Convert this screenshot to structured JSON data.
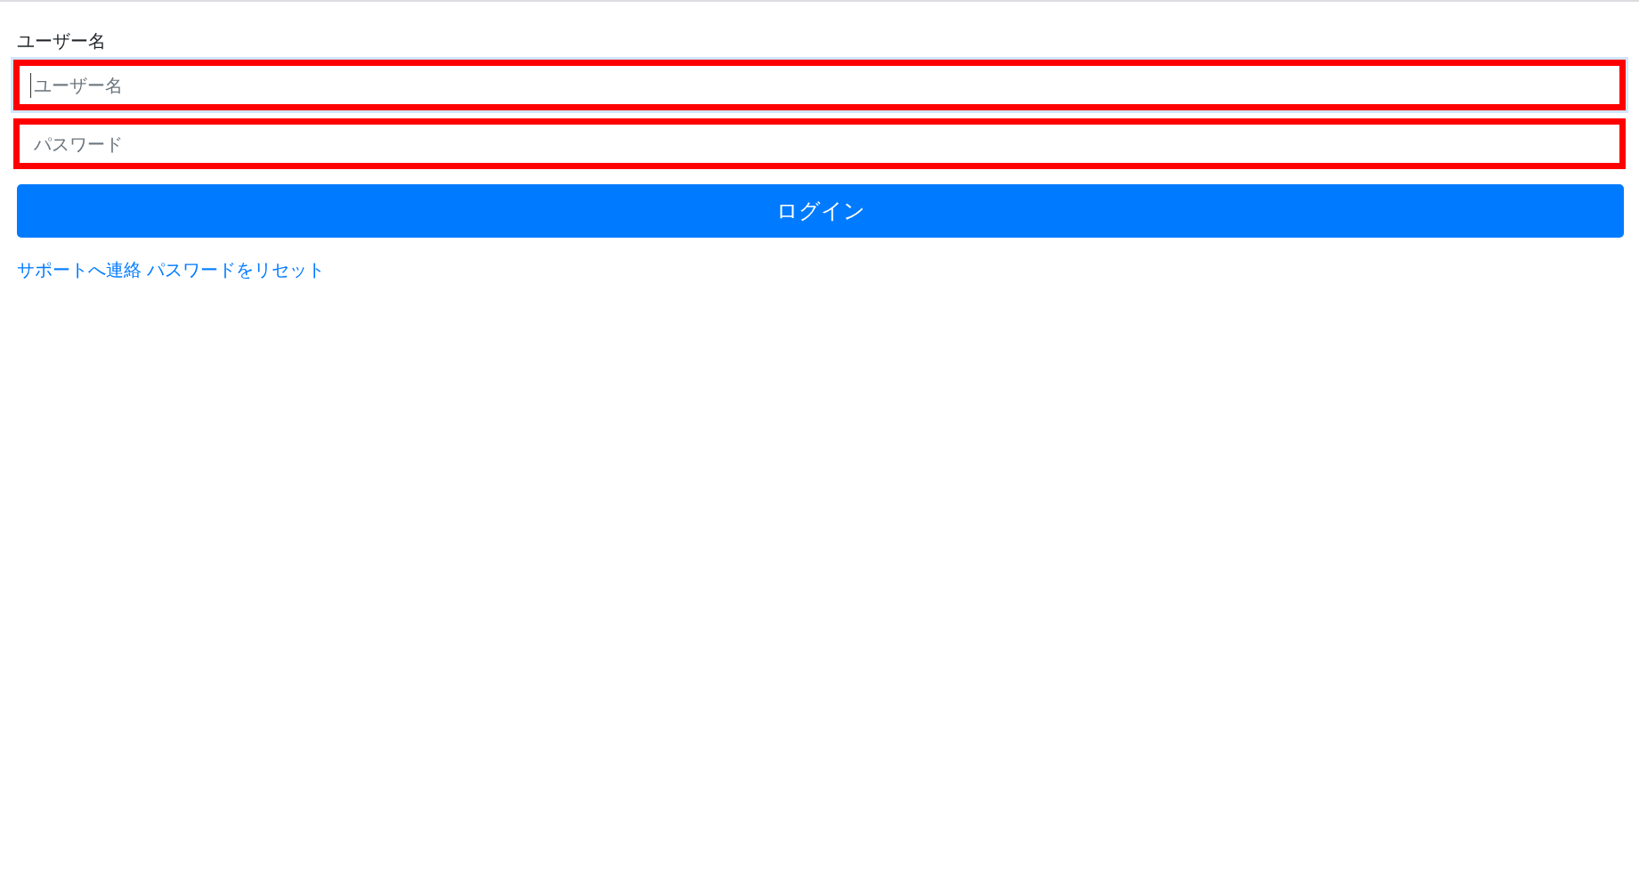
{
  "login_form": {
    "label": "ユーザー名",
    "fields": [
      {
        "placeholder": "ユーザー名",
        "focused": true,
        "highlighted": true
      },
      {
        "placeholder": "パスワード",
        "focused": false,
        "highlighted": true
      }
    ],
    "submit_button": "ログイン",
    "links": [
      "サポートへ連絡",
      "パスワードをリセット"
    ]
  }
}
